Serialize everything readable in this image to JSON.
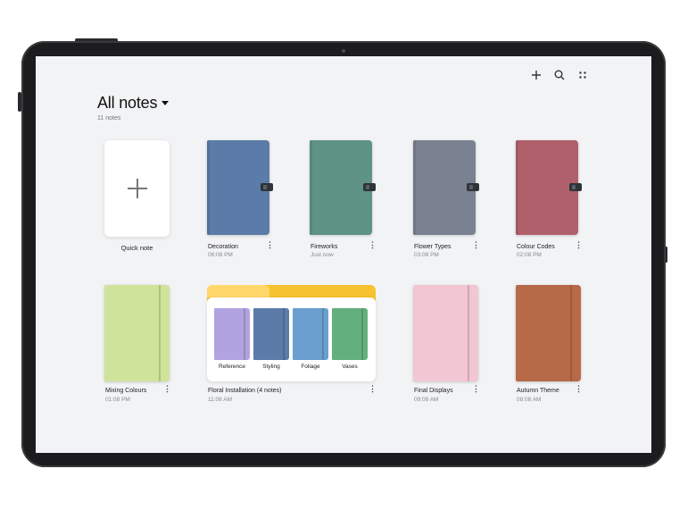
{
  "header": {
    "title": "All notes",
    "count": "11 notes"
  },
  "toolbar": {
    "add_icon": "plus-icon",
    "search_icon": "search-icon",
    "more_icon": "grid-dots-icon"
  },
  "quick_note": {
    "label": "Quick note"
  },
  "notes": [
    {
      "name": "Decoration",
      "time": "06:08 PM",
      "color": "#5b7ca8"
    },
    {
      "name": "Fireworks",
      "time": "Just now",
      "color": "#5e9386"
    },
    {
      "name": "Flower Types",
      "time": "03:08 PM",
      "color": "#7a8190"
    },
    {
      "name": "Colour Codes",
      "time": "02:08 PM",
      "color": "#b0606a"
    },
    {
      "name": "Mixing Colours",
      "time": "01:08 PM",
      "color": "#cfe39a"
    },
    {
      "name": "Final Displays",
      "time": "09:08 AM",
      "color": "#f2c6d2"
    },
    {
      "name": "Autumn Theme",
      "time": "08:08 AM",
      "color": "#b76a48"
    }
  ],
  "folder": {
    "name": "Floral Installation",
    "count": "(4 notes)",
    "time": "11:08 AM",
    "items": [
      {
        "label": "Reference",
        "color": "#b1a3e0"
      },
      {
        "label": "Styling",
        "color": "#5b7ca8"
      },
      {
        "label": "Foliage",
        "color": "#6a9fd0"
      },
      {
        "label": "Vases",
        "color": "#63b07e"
      }
    ]
  }
}
